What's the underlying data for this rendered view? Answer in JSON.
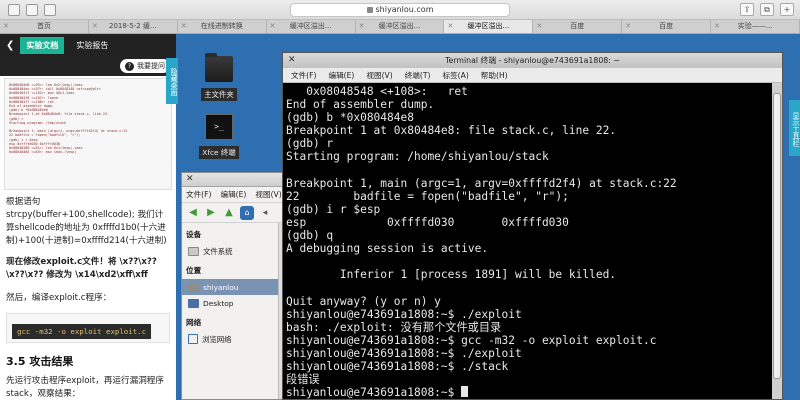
{
  "browser": {
    "url": "shiyanlou.com",
    "tabs": [
      {
        "label": "首页",
        "active": false
      },
      {
        "label": "2018-5-2 缓...",
        "active": false
      },
      {
        "label": "在线进制转换",
        "active": false
      },
      {
        "label": "缓冲区溢出...",
        "active": false
      },
      {
        "label": "缓冲区溢出...",
        "active": false
      },
      {
        "label": "缓冲区溢出...",
        "active": true
      },
      {
        "label": "百度",
        "active": false
      },
      {
        "label": "百度",
        "active": false
      },
      {
        "label": "实验——...",
        "active": false
      }
    ]
  },
  "doc": {
    "tab_docs": "实验文档",
    "tab_report": "实验报告",
    "help_label": "我要提问",
    "side_label": "隐藏桌面",
    "thumb_lines": [
      "0x080484e8 <+93>:   lea    0x2(%esp),%eax",
      "0x080484ec <+97>:   call   0x8048340 <strcpy@plt>",
      "0x080484f1 <+102>:  mov    $0x1,%eax",
      "0x080484f6 <+107>:  leave",
      "0x080484f7 <+108>:  ret",
      "End of assembler dump.",
      "(gdb) b *0x080484e8",
      "Breakpoint 1 at 0x80484e8: file stack.c, line 22.",
      "(gdb) r",
      "Starting program: /tmp/stack",
      "",
      "Breakpoint 1, main (argc=1, argv=0xffffd2f4) at stack.c:22",
      "22        badfile = fopen(\"badfile\", \"r\");",
      "(gdb) i r $esp",
      "esp            0xffffd030       0xffffd030",
      "0x08048480 <+61>:   lea    0x1(%esp),%eax",
      "0x08048484 <+65>:   mov    %eax,(%esp)"
    ],
    "para1": "根据语句 strcpy(buffer+100,shellcode); 我们计算shellcode的地址为 0xffffd1b0(十六进制)+100(十进制)=0xffffd214(十六进制)",
    "para2": "现在修改exploit.c文件！将 \\x??\\x??\\x??\\x?? 修改为 \\x14\\xd2\\xff\\xff",
    "para3": "然后，编译exploit.c程序：",
    "code": "gcc -m32 -o exploit exploit.c",
    "heading": "3.5 攻击结果",
    "para4": "先运行攻击程序exploit，再运行漏洞程序stack，观察结果："
  },
  "desktop": {
    "icon_home": "主文件夹",
    "icon_term": "Xfce 终端",
    "right_strip": "显示工具栏"
  },
  "file_manager": {
    "menu": [
      "文件(F)",
      "编辑(E)",
      "视图(V)"
    ],
    "sec_devices": "设备",
    "item_fs": "文件系统",
    "sec_places": "位置",
    "item_home": "shiyanlou",
    "item_desktop": "Desktop",
    "sec_network": "网络",
    "item_network": "浏览网络"
  },
  "terminal": {
    "title": "Terminal 终端 - shiyanlou@e743691a1808: ~",
    "menu": [
      "文件(F)",
      "编辑(E)",
      "视图(V)",
      "终端(T)",
      "标签(A)",
      "帮助(H)"
    ],
    "lines": [
      "   0x08048548 <+108>:   ret",
      "End of assembler dump.",
      "(gdb) b *0x080484e8",
      "Breakpoint 1 at 0x80484e8: file stack.c, line 22.",
      "(gdb) r",
      "Starting program: /home/shiyanlou/stack",
      "",
      "Breakpoint 1, main (argc=1, argv=0xffffd2f4) at stack.c:22",
      "22        badfile = fopen(\"badfile\", \"r\");",
      "(gdb) i r $esp",
      "esp            0xffffd030       0xffffd030",
      "(gdb) q",
      "A debugging session is active.",
      "",
      "        Inferior 1 [process 1891] will be killed.",
      "",
      "Quit anyway? (y or n) y",
      "shiyanlou@e743691a1808:~$ ./exploit",
      "bash: ./exploit: 没有那个文件或目录",
      "shiyanlou@e743691a1808:~$ gcc -m32 -o exploit exploit.c",
      "shiyanlou@e743691a1808:~$ ./exploit",
      "shiyanlou@e743691a1808:~$ ./stack",
      "段错误",
      "shiyanlou@e743691a1808:~$ "
    ]
  }
}
